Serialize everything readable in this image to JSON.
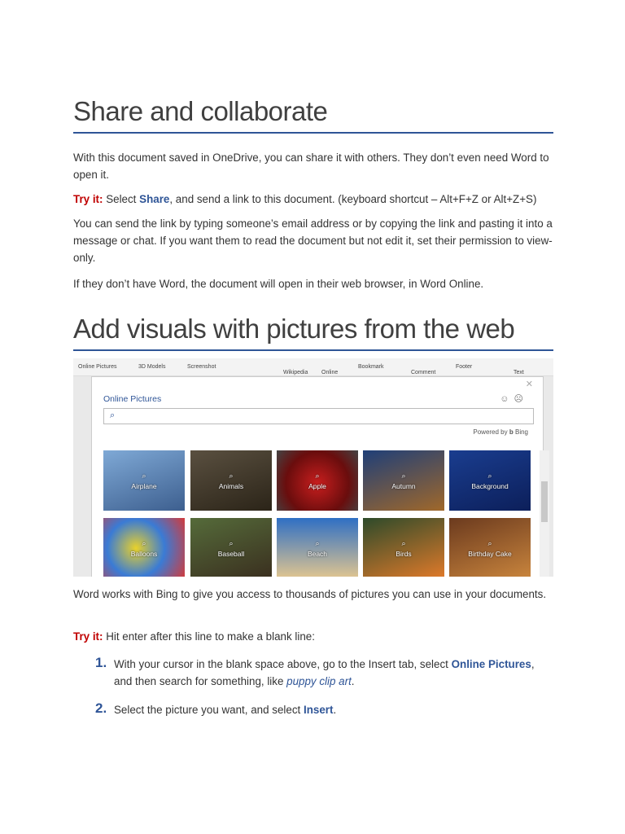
{
  "section1": {
    "heading": "Share and collaborate",
    "p1": "With this document saved in OneDrive, you can share it with others. They don’t even need Word to open it.",
    "try_label": "Try it:",
    "try_pre": " Select ",
    "try_bold": "Share",
    "try_post": ", and send a link to this document. (keyboard shortcut – Alt+F+Z or Alt+Z+S)",
    "p3": "You can send the link by typing someone’s email address or by copying the link and pasting it into a message or chat. If you want them to read the document but not edit it, set their permission to view-only.",
    "p4": "If they don’t have Word, the document will open in their web browser, in Word Online."
  },
  "section2": {
    "heading": "Add visuals with pictures from the web",
    "p1": "Word works with Bing to give you access to thousands of pictures you can use in your documents.",
    "try_label": "Try it:",
    "try_text": " Hit enter after this line to make a blank line:",
    "steps": [
      {
        "num": "1.",
        "pre": "With your cursor in the blank space above, go to the Insert tab, select ",
        "bold": "Online Pictures",
        "mid": ", and then search for something, like ",
        "link": "puppy clip art",
        "post": "."
      },
      {
        "num": "2.",
        "pre": "Select the picture you want, and select ",
        "bold": "Insert",
        "post": "."
      }
    ]
  },
  "screenshot": {
    "toolbar": [
      "Online Pictures",
      "3D Models",
      "Screenshot",
      "Wikipedia",
      "Online",
      "Bookmark",
      "Comment",
      "Footer",
      "Text"
    ],
    "dialog_title": "Online Pictures",
    "powered_by": "Powered by",
    "bing": "Bing",
    "tiles": [
      "Airplane",
      "Animals",
      "Apple",
      "Autumn",
      "Background",
      "Balloons",
      "Baseball",
      "Beach",
      "Birds",
      "Birthday Cake"
    ],
    "tile_colors": [
      "linear-gradient(160deg,#7fa9d6,#3d5f8f)",
      "linear-gradient(160deg,#5a5040,#2b2418)",
      "radial-gradient(circle at 50% 55%,#c81e1e,#6a0d0d 60%,#444)",
      "linear-gradient(160deg,#1f3f78,#a0682a)",
      "linear-gradient(160deg,#1a3d8f,#0c1f5a)",
      "radial-gradient(circle at 40% 50%,#e9d12a,#3a7bd5 50%,#d43a3a)",
      "linear-gradient(160deg,#556b3a,#3a2f1f)",
      "linear-gradient(180deg,#2f6fc4,#e0c590)",
      "linear-gradient(160deg,#2d4a2a,#e07a2a)",
      "linear-gradient(160deg,#6b3a1e,#c9853d)"
    ]
  }
}
